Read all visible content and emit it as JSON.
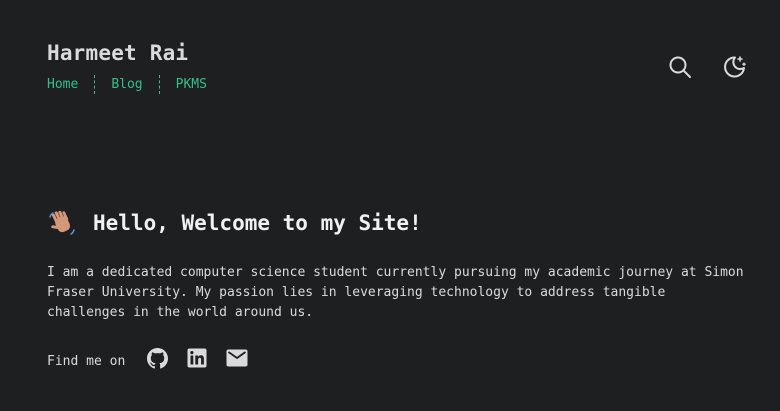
{
  "header": {
    "site_title": "Harmeet Rai",
    "nav": [
      {
        "label": "Home"
      },
      {
        "label": "Blog"
      },
      {
        "label": "PKMS"
      }
    ]
  },
  "hero": {
    "emoji": "waving-hand",
    "title": "Hello, Welcome to my Site!",
    "paragraph": "I am a dedicated computer science student currently pursuing my academic journey at Simon Fraser University. My passion lies in leveraging technology to address tangible challenges in the world around us."
  },
  "social": {
    "label": "Find me on",
    "links": [
      {
        "icon": "github-icon"
      },
      {
        "icon": "linkedin-icon"
      },
      {
        "icon": "email-icon"
      }
    ]
  },
  "colors": {
    "background": "#1e1f21",
    "text": "#dadadb",
    "accent": "#35bf86"
  }
}
